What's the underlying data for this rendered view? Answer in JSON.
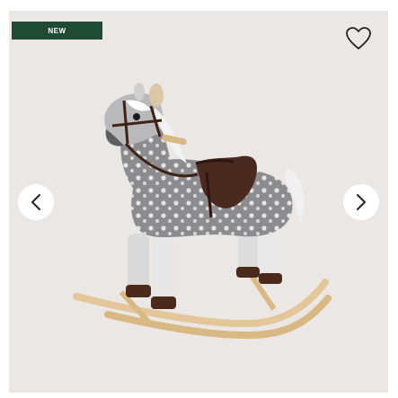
{
  "header": {
    "clipped_text": ""
  },
  "product_card": {
    "badge": "NEW",
    "wishlist_icon": "heart-outline-icon",
    "prev_icon": "chevron-left-icon",
    "next_icon": "chevron-right-icon",
    "image": "rocking-horse-photo"
  },
  "colors": {
    "card_bg": "#ebe7e4",
    "badge_bg": "#1f4a33",
    "badge_text": "#ffffff"
  }
}
